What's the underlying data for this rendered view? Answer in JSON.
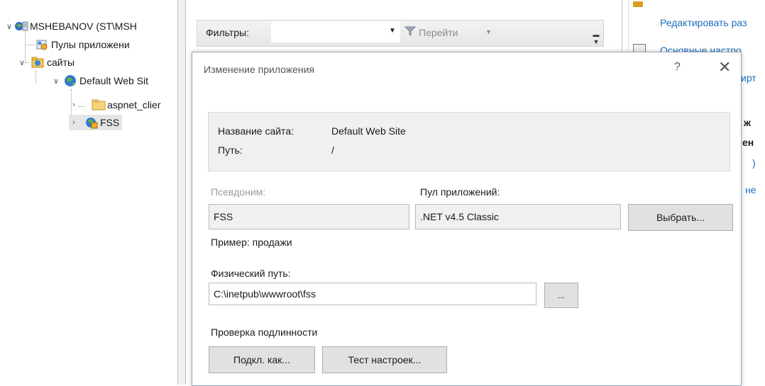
{
  "tree": {
    "server": "MSHEBANOV (ST\\MSH",
    "app_pools": "Пулы приложени",
    "sites": "сайты",
    "default_site": "Default Web Sit",
    "aspnet": "aspnet_clier",
    "fss": "FSS"
  },
  "toolbar": {
    "filters_label": "Фильтры:",
    "go_label": "Перейти"
  },
  "actions": {
    "edit": "Редактировать раз",
    "basic": "Основные настро",
    "frag1": "ирт",
    "frag2": "ж",
    "frag3": "ен",
    "frag4": ")",
    "frag5": "не"
  },
  "dialog": {
    "title": "Изменение приложения",
    "help": "?",
    "close": "✕",
    "site_name_label": "Название сайта:",
    "site_name_value": "Default Web Site",
    "path_label": "Путь:",
    "path_value": "/",
    "alias_label": "Псевдоним:",
    "alias_value": "FSS",
    "pool_label": "Пул приложений:",
    "pool_value": ".NET v4.5 Classic",
    "select_button": "Выбрать...",
    "example": "Пример: продажи",
    "physical_path_label": "Физический путь:",
    "physical_path_value": "C:\\inetpub\\wwwroot\\fss",
    "browse_button": "...",
    "auth_label": "Проверка подлинности",
    "connect_as_button": "Подкл. как...",
    "test_settings_button": "Тест настроек..."
  }
}
